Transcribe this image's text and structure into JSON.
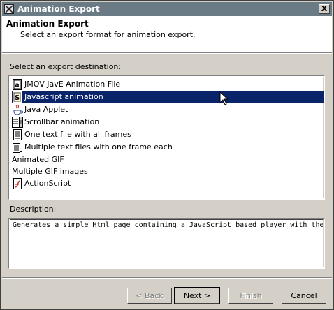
{
  "window": {
    "title": "Animation Export",
    "close_label": "X"
  },
  "header": {
    "title": "Animation Export",
    "description": "Select an export format for animation export."
  },
  "destination_label": "Select an export destination:",
  "destinations": [
    {
      "label": "JMOV JavE Animation File",
      "icon": "jmov-file-icon"
    },
    {
      "label": "Javascript animation",
      "icon": "javascript-icon",
      "selected": true
    },
    {
      "label": "Java Applet",
      "icon": "java-coffee-icon"
    },
    {
      "label": "Scrollbar animation",
      "icon": "scrollbar-icon"
    },
    {
      "label": "One text file with all frames",
      "icon": "text-file-icon"
    },
    {
      "label": "Multiple text files with one frame each",
      "icon": "text-files-icon"
    },
    {
      "label": "Animated GIF",
      "icon": ""
    },
    {
      "label": "Multiple GIF images",
      "icon": ""
    },
    {
      "label": "ActionScript",
      "icon": "actionscript-icon"
    }
  ],
  "description_label": "Description:",
  "description_text": "Generates a simple Html page containing a JavaScript based player with the animation.",
  "buttons": {
    "back": "< Back",
    "next": "Next >",
    "finish": "Finish",
    "cancel": "Cancel"
  },
  "colors": {
    "titlebar": "#6b7b86",
    "selection": "#0a246a",
    "face": "#d4d0c8"
  }
}
